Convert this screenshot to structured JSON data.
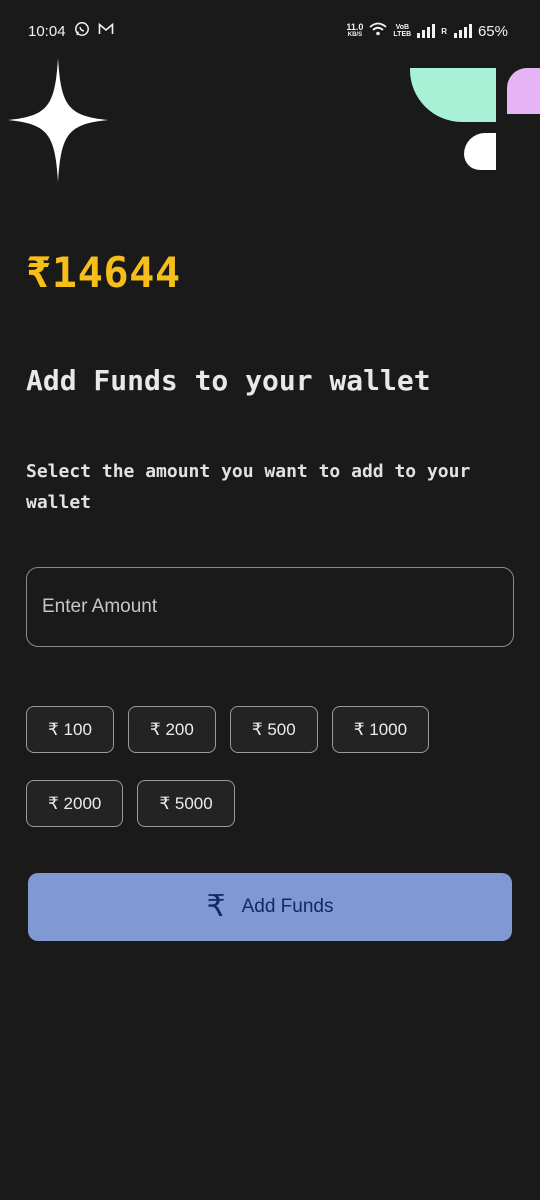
{
  "status_bar": {
    "time": "10:04",
    "net_speed_value": "11.0",
    "net_speed_unit": "KB/S",
    "volte_top": "VoB",
    "volte_bottom": "LTEB",
    "sim2_label": "R",
    "battery": "65%"
  },
  "wallet": {
    "balance": "₹14644",
    "title": "Add Funds to your wallet",
    "subtitle": "Select the amount you want to add to your wallet",
    "input_placeholder": "Enter Amount"
  },
  "chips_row1": [
    "₹ 100",
    "₹ 200",
    "₹ 500",
    "₹ 1000"
  ],
  "chips_row2": [
    "₹ 2000",
    "₹ 5000"
  ],
  "add_button": {
    "icon_glyph": "₹",
    "label": "Add Funds"
  },
  "colors": {
    "background": "#1a1a1a",
    "balance": "#f6be19",
    "button_bg": "#8099d3",
    "button_text": "#0f2a6b",
    "mint": "#a8f0d6",
    "lavender": "#e6b3f5"
  }
}
